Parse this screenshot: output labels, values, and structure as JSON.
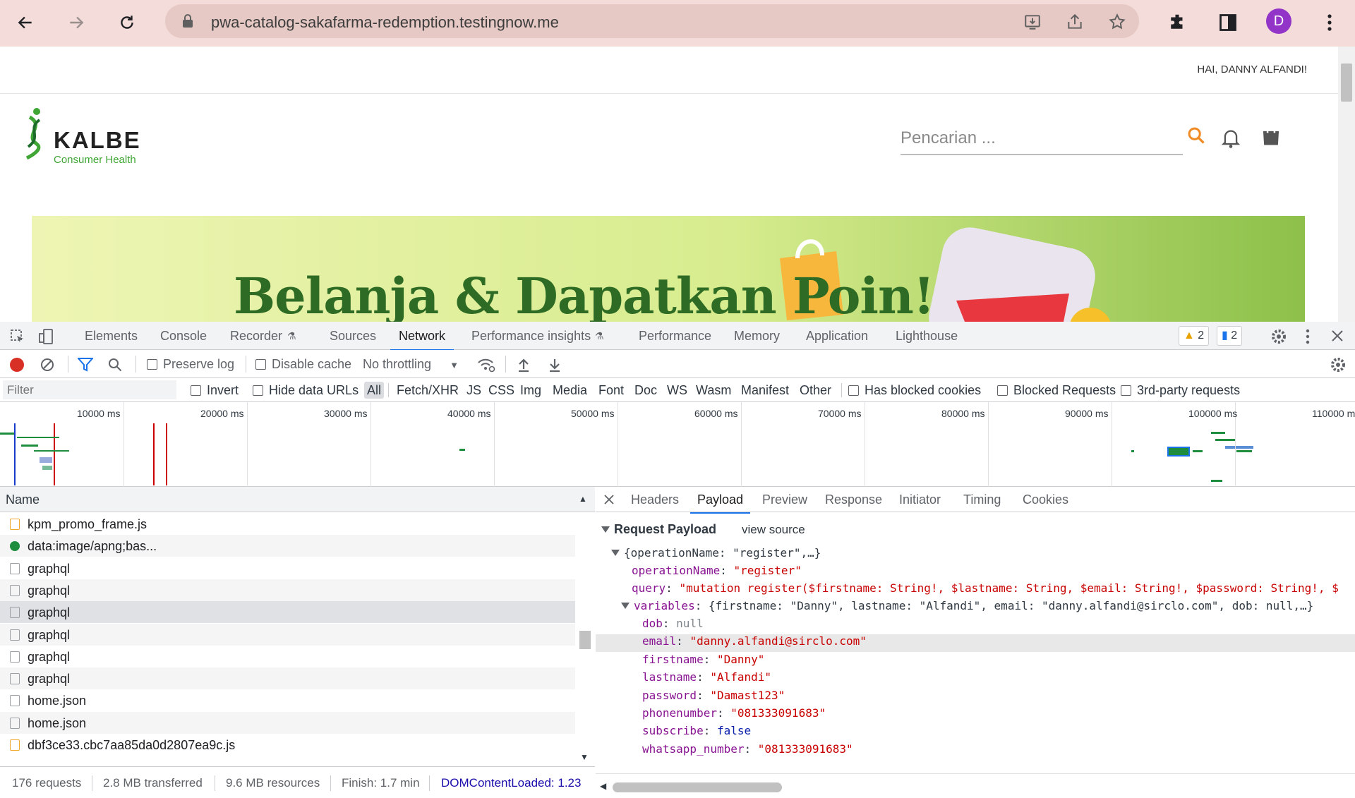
{
  "browser": {
    "url": "pwa-catalog-sakafarma-redemption.testingnow.me",
    "avatar_letter": "D"
  },
  "page": {
    "greeting": "HAI, DANNY ALFANDI!",
    "logo_name": "KALBE",
    "logo_sub": "Consumer Health",
    "search_placeholder": "Pencarian ...",
    "banner_text": "Belanja & Dapatkan Poin!"
  },
  "devtools": {
    "tabs": [
      "Elements",
      "Console",
      "Recorder",
      "Sources",
      "Network",
      "Performance insights",
      "Performance",
      "Memory",
      "Application",
      "Lighthouse"
    ],
    "warnings_count": "2",
    "messages_count": "2",
    "toolbar": {
      "preserve_log": "Preserve log",
      "disable_cache": "Disable cache",
      "throttling": "No throttling"
    },
    "filter": {
      "placeholder": "Filter",
      "invert": "Invert",
      "hide_data_urls": "Hide data URLs",
      "types": [
        "All",
        "Fetch/XHR",
        "JS",
        "CSS",
        "Img",
        "Media",
        "Font",
        "Doc",
        "WS",
        "Wasm",
        "Manifest",
        "Other"
      ],
      "blocked_cookies": "Has blocked cookies",
      "blocked_requests": "Blocked Requests",
      "third_party": "3rd-party requests"
    },
    "timeline_ticks": [
      "10000 ms",
      "20000 ms",
      "30000 ms",
      "40000 ms",
      "50000 ms",
      "60000 ms",
      "70000 ms",
      "80000 ms",
      "90000 ms",
      "100000 ms",
      "110000 m"
    ],
    "list_header": "Name",
    "requests": [
      {
        "name": "kpm_promo_frame.js",
        "type": "js"
      },
      {
        "name": "data:image/apng;bas...",
        "type": "img"
      },
      {
        "name": "graphql",
        "type": "doc"
      },
      {
        "name": "graphql",
        "type": "doc"
      },
      {
        "name": "graphql",
        "type": "doc"
      },
      {
        "name": "graphql",
        "type": "doc"
      },
      {
        "name": "graphql",
        "type": "doc"
      },
      {
        "name": "graphql",
        "type": "doc"
      },
      {
        "name": "home.json",
        "type": "doc"
      },
      {
        "name": "home.json",
        "type": "doc"
      },
      {
        "name": "dbf3ce33.cbc7aa85da0d2807ea9c.js",
        "type": "js"
      }
    ],
    "detail_tabs": [
      "Headers",
      "Payload",
      "Preview",
      "Response",
      "Initiator",
      "Timing",
      "Cookies"
    ],
    "payload": {
      "section_title": "Request Payload",
      "view_source": "view source",
      "summary": "{operationName: \"register\",…}",
      "operationName_key": "operationName",
      "operationName_val": "\"register\"",
      "query_key": "query",
      "query_val": "\"mutation register($firstname: String!, $lastname: String, $email: String!, $password: String!, $",
      "variables_key": "variables",
      "variables_summary": "{firstname: \"Danny\", lastname: \"Alfandi\", email: \"danny.alfandi@sirclo.com\", dob: null,…}",
      "fields": [
        {
          "key": "dob",
          "val": "null",
          "kind": "g"
        },
        {
          "key": "email",
          "val": "\"danny.alfandi@sirclo.com\"",
          "kind": "s"
        },
        {
          "key": "firstname",
          "val": "\"Danny\"",
          "kind": "s"
        },
        {
          "key": "lastname",
          "val": "\"Alfandi\"",
          "kind": "s"
        },
        {
          "key": "password",
          "val": "\"Damast123\"",
          "kind": "s"
        },
        {
          "key": "phonenumber",
          "val": "\"081333091683\"",
          "kind": "s"
        },
        {
          "key": "subscribe",
          "val": "false",
          "kind": "n"
        },
        {
          "key": "whatsapp_number",
          "val": "\"081333091683\"",
          "kind": "s"
        }
      ]
    },
    "status": {
      "requests": "176 requests",
      "transferred": "2.8 MB transferred",
      "resources": "9.6 MB resources",
      "finish": "Finish: 1.7 min",
      "dcl": "DOMContentLoaded: 1.23"
    }
  }
}
